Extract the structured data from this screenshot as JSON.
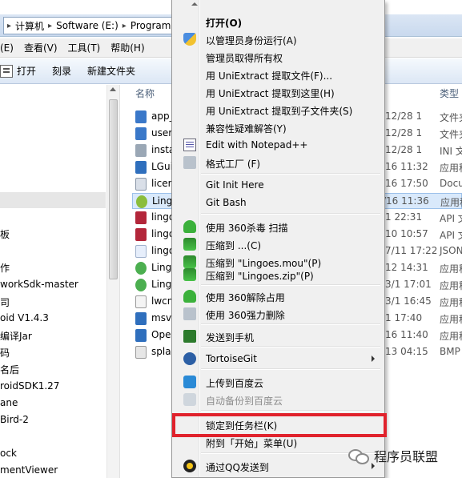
{
  "address_bar": {
    "crumbs": [
      "计算机",
      "Software (E:)",
      "Program"
    ]
  },
  "menu_bar": {
    "items": [
      "(E)",
      "查看(V)",
      "工具(T)",
      "帮助(H)"
    ]
  },
  "toolbar": {
    "open_label": "打开",
    "burn_label": "刻录",
    "new_folder_label": "新建文件夹"
  },
  "nav_pane": {
    "items": [
      "板",
      "作",
      "workSdk-master",
      "司",
      "oid V1.4.3",
      "编译Jar",
      "码",
      "名后",
      "roidSDK1.27",
      "ane",
      "Bird-2",
      "ock",
      "mentViewer"
    ]
  },
  "file_list": {
    "col_name": "名称",
    "col_type": "类型",
    "rows": [
      {
        "name": "app_d",
        "date": "/12/28 1",
        "type": "文件夹"
      },
      {
        "name": "user_c",
        "date": "/12/28 1",
        "type": "文件夹"
      },
      {
        "name": "install",
        "date": "/12/28 1",
        "type": "INI 文件"
      },
      {
        "name": "LGui3.",
        "date": "/16 11:32",
        "type": "应用程"
      },
      {
        "name": "licens",
        "date": "/16 17:50",
        "type": "Docum"
      },
      {
        "name": "Lingoe",
        "date": "/16 11:36",
        "type": "应用程"
      },
      {
        "name": "lingoe",
        "date": "/1 22:31",
        "type": "API 文"
      },
      {
        "name": "lingoe",
        "date": "/10 10:57",
        "type": "API 文"
      },
      {
        "name": "lingoe",
        "date": "/7/11 17:22",
        "type": "JSON"
      },
      {
        "name": "Lingoe",
        "date": "/12 14:31",
        "type": "应用程"
      },
      {
        "name": "Lingoe",
        "date": "/3/1 17:01",
        "type": "应用程"
      },
      {
        "name": "lwcnc",
        "date": "/3/1 16:45",
        "type": "应用程"
      },
      {
        "name": "msvcp",
        "date": "/1 17:40",
        "type": "应用程"
      },
      {
        "name": "OpenT",
        "date": "/16 11:40",
        "type": "应用程"
      },
      {
        "name": "splash",
        "date": "/13 04:15",
        "type": "BMP"
      }
    ]
  },
  "context_menu": {
    "items": [
      {
        "label": "打开(O)",
        "bold": true
      },
      {
        "label": "以管理员身份运行(A)"
      },
      {
        "label": "管理员取得所有权"
      },
      {
        "label": "用 UniExtract 提取文件(F)..."
      },
      {
        "label": "用 UniExtract 提取到这里(H)"
      },
      {
        "label": "用 UniExtract 提取到子文件夹(S)"
      },
      {
        "label": "兼容性疑难解答(Y)"
      },
      {
        "label": "Edit with Notepad++"
      },
      {
        "label": "格式工厂 (F)"
      },
      {
        "label": "Git Init Here"
      },
      {
        "label": "Git Bash"
      },
      {
        "label": "使用 360杀毒 扫描"
      },
      {
        "label": "压缩到 ...(C)"
      },
      {
        "label": "压缩到 \"Lingoes.mou\"(P)"
      },
      {
        "label": "压缩到 \"Lingoes.zip\"(P)"
      },
      {
        "label": "使用 360解除占用"
      },
      {
        "label": "使用 360强力删除"
      },
      {
        "label": "发送到手机"
      },
      {
        "label": "TortoiseGit"
      },
      {
        "label": "上传到百度云"
      },
      {
        "label": "自动备份到百度云",
        "disabled": true
      },
      {
        "label": "锁定到任务栏(K)"
      },
      {
        "label": "附到「开始」菜单(U)"
      },
      {
        "label": "通过QQ发送到"
      }
    ]
  },
  "highlight_color": "#e0222c",
  "watermark": {
    "text": "程序员联盟"
  }
}
